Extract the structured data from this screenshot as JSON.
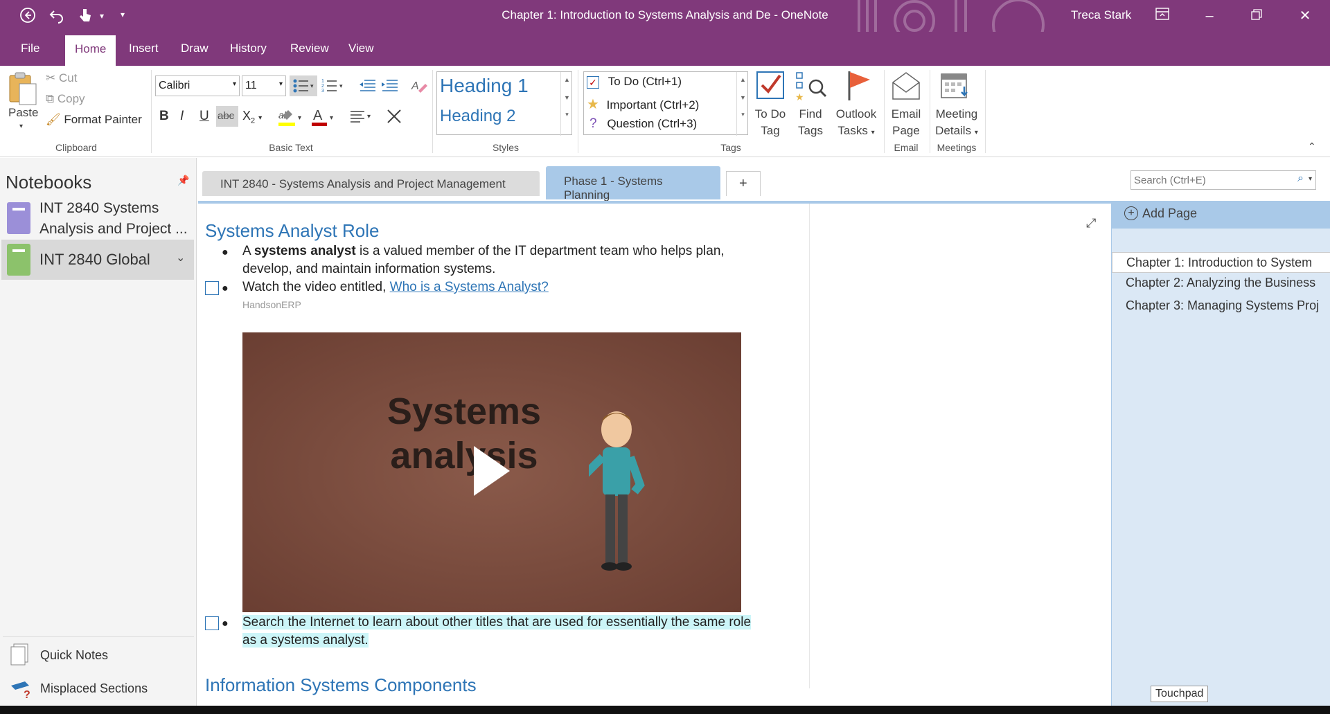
{
  "window": {
    "title": "Chapter 1: Introduction to Systems Analysis and De  -  OneNote",
    "user": "Treca Stark"
  },
  "menu": {
    "tabs": [
      "File",
      "Home",
      "Insert",
      "Draw",
      "History",
      "Review",
      "View"
    ],
    "active": "Home"
  },
  "ribbon": {
    "clipboard": {
      "paste": "Paste",
      "cut": "Cut",
      "copy": "Copy",
      "format_painter": "Format Painter",
      "group_label": "Clipboard"
    },
    "basic_text": {
      "font": "Calibri",
      "size": "11",
      "group_label": "Basic Text",
      "font_color": "#c00000",
      "highlight_color": "#ffff00"
    },
    "styles": {
      "items": [
        "Heading 1",
        "Heading 2"
      ],
      "group_label": "Styles"
    },
    "tags": {
      "items": [
        "To Do (Ctrl+1)",
        "Important (Ctrl+2)",
        "Question (Ctrl+3)"
      ],
      "todo_tag_line1": "To Do",
      "todo_tag_line2": "Tag",
      "find_tags_line1": "Find",
      "find_tags_line2": "Tags",
      "outlook_tasks_line1": "Outlook",
      "outlook_tasks_line2": "Tasks",
      "group_label": "Tags"
    },
    "email": {
      "line1": "Email",
      "line2": "Page",
      "group_label": "Email"
    },
    "meetings": {
      "line1": "Meeting",
      "line2": "Details",
      "group_label": "Meetings"
    }
  },
  "notebooks": {
    "title": "Notebooks",
    "items": [
      {
        "line1": "INT 2840 Systems",
        "line2": "Analysis and Project ...",
        "color": "#9b8fd8"
      },
      {
        "line1": "INT 2840 Global",
        "color": "#8cc26b"
      }
    ],
    "quick_notes": "Quick Notes",
    "misplaced_sections": "Misplaced Sections"
  },
  "sections": {
    "tabs": [
      "INT 2840 - Systems Analysis and Project Management",
      "Phase 1 - Systems Planning"
    ],
    "active": "Phase 1 - Systems Planning",
    "add": "+"
  },
  "search": {
    "placeholder": "Search (Ctrl+E)"
  },
  "page": {
    "heading": "Systems Analyst Role",
    "bullet1_pre": "A ",
    "bullet1_bold": "systems analyst",
    "bullet1_post": " is a valued member of the IT department team who helps plan,",
    "bullet1_line2": "develop, and maintain information systems.",
    "bullet2_pre": "Watch the video entitled, ",
    "bullet2_link": "Who is a Systems Analyst?",
    "video_source": "HandsonERP",
    "video_title_line1": "Systems",
    "video_title_line2": "analysis",
    "bullet3_line1": "Search the Internet to learn about other titles that are used for essentially the same role",
    "bullet3_line2": "as a systems analyst.",
    "heading2": "Information Systems Components"
  },
  "pages_pane": {
    "add_page": "Add Page",
    "items": [
      "Chapter 1: Introduction to System",
      "Chapter 2: Analyzing the Business",
      "Chapter 3: Managing Systems Proj"
    ],
    "active_index": 0
  },
  "tooltip": "Touchpad"
}
